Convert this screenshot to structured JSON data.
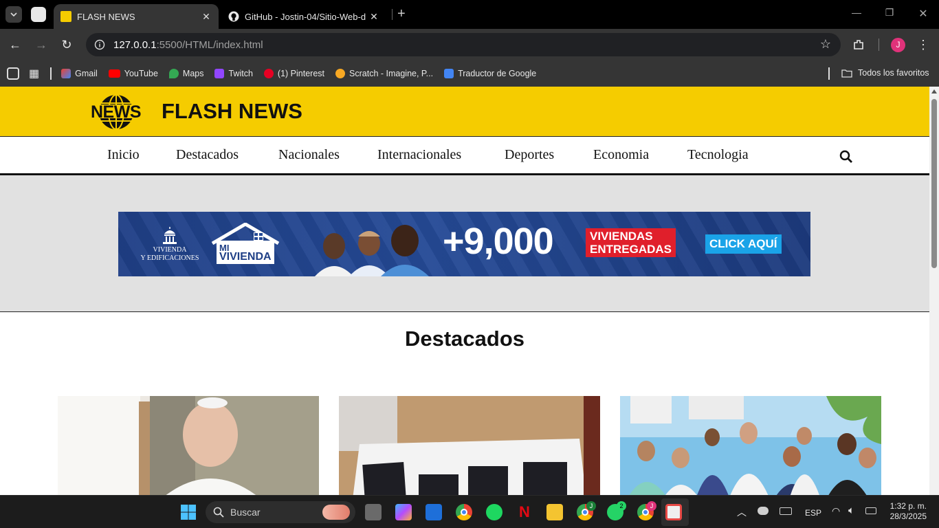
{
  "browser": {
    "tabs": [
      {
        "title": "FLASH NEWS",
        "active": true
      },
      {
        "title": "GitHub - Jostin-04/Sitio-Web-d",
        "active": false
      }
    ],
    "url_host": "127.0.0.1",
    "url_path": ":5500/HTML/index.html",
    "bookmarks": [
      "Gmail",
      "YouTube",
      "Maps",
      "Twitch",
      "(1) Pinterest",
      "Scratch - Imagine, P...",
      "Traductor de Google"
    ],
    "all_bookmarks": "Todos los favoritos",
    "profile_initial": "J"
  },
  "site": {
    "logo_text": "NEWS",
    "title": "FLASH NEWS",
    "nav": [
      "Inicio",
      "Destacados",
      "Nacionales",
      "Internacionales",
      "Deportes",
      "Economia",
      "Tecnologia"
    ]
  },
  "banner": {
    "org_line1": "VIVIENDA",
    "org_line2": "Y EDIFICACIONES",
    "brand_line1": "MI",
    "brand_line2": "VIVIENDA",
    "number": "+9,000",
    "tag_line1": "VIVIENDAS",
    "tag_line2": "ENTREGADAS",
    "cta": "CLICK AQUÍ"
  },
  "section": {
    "title": "Destacados"
  },
  "taskbar": {
    "search_placeholder": "Buscar",
    "whatsapp_badge": "2",
    "chrome_badge_1": "J",
    "chrome_badge_2": "J",
    "lang": "ESP",
    "time": "1:32 p. m.",
    "date": "28/3/2025"
  },
  "colors": {
    "header_yellow": "#f5cc00",
    "chrome_dark": "#353535",
    "banner_blue": "#254a96",
    "banner_red": "#e01f2b",
    "cta_blue": "#1aa3e8"
  }
}
